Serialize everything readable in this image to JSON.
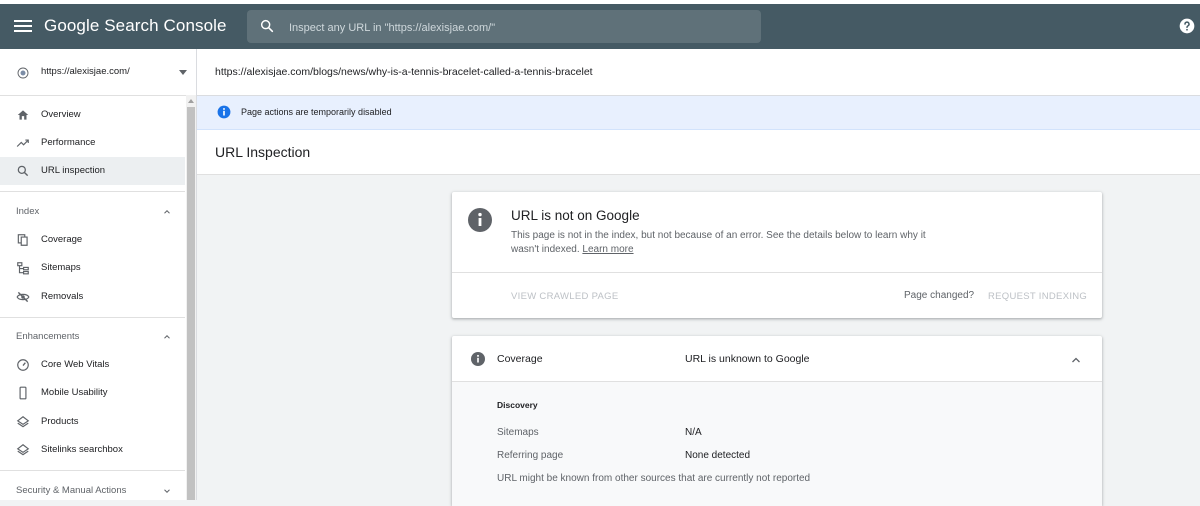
{
  "header": {
    "app_title": "Google Search Console",
    "search_placeholder": "Inspect any URL in \"https://alexisjae.com/\""
  },
  "sidebar": {
    "property": "https://alexisjae.com/",
    "top_items": [
      {
        "label": "Overview",
        "icon": "home-icon"
      },
      {
        "label": "Performance",
        "icon": "trending-up-icon"
      },
      {
        "label": "URL inspection",
        "icon": "search-icon",
        "active": true
      }
    ],
    "sections": [
      {
        "label": "Index",
        "items": [
          {
            "label": "Coverage",
            "icon": "file-copy-icon"
          },
          {
            "label": "Sitemaps",
            "icon": "sitemap-icon"
          },
          {
            "label": "Removals",
            "icon": "visibility-off-icon"
          }
        ]
      },
      {
        "label": "Enhancements",
        "items": [
          {
            "label": "Core Web Vitals",
            "icon": "speed-gauge-icon"
          },
          {
            "label": "Mobile Usability",
            "icon": "smartphone-icon"
          },
          {
            "label": "Products",
            "icon": "diamond-icon"
          },
          {
            "label": "Sitelinks searchbox",
            "icon": "diamond-icon"
          }
        ]
      },
      {
        "label": "Security & Manual Actions",
        "items": []
      }
    ]
  },
  "main": {
    "inspected_url": "https://alexisjae.com/blogs/news/why-is-a-tennis-bracelet-called-a-tennis-bracelet",
    "banner_text": "Page actions are temporarily disabled",
    "page_title": "URL Inspection",
    "status_card": {
      "title": "URL is not on Google",
      "description": "This page is not in the index, but not because of an error. See the details below to learn why it wasn't indexed.",
      "learn_more": "Learn more",
      "view_crawled": "VIEW CRAWLED PAGE",
      "page_changed": "Page changed?",
      "request_indexing": "REQUEST INDEXING"
    },
    "coverage_card": {
      "label": "Coverage",
      "value": "URL is unknown to Google",
      "discovery_heading": "Discovery",
      "rows": [
        {
          "label": "Sitemaps",
          "value": "N/A"
        },
        {
          "label": "Referring page",
          "value": "None detected"
        }
      ],
      "note": "URL might be known from other sources that are currently not reported"
    }
  },
  "colors": {
    "header_bg": "#455a64",
    "search_bg": "#5f7179",
    "banner_bg": "#e8f0fe",
    "info_blue": "#1a73e8",
    "active_nav_bg": "#eceff1"
  }
}
